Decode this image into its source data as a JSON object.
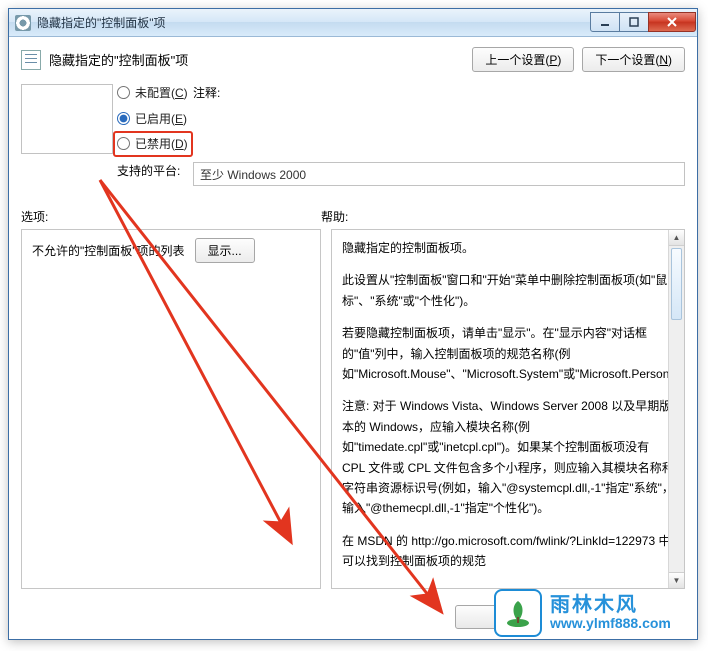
{
  "window": {
    "title": "隐藏指定的\"控制面板\"项"
  },
  "header": {
    "doc_title": "隐藏指定的\"控制面板\"项",
    "prev_label": "上一个设置(",
    "prev_key": "P",
    "next_label": "下一个设置(",
    "next_key": "N",
    "close_paren": ")"
  },
  "radios": {
    "not_configured": "未配置(",
    "not_configured_key": "C",
    "enabled": "已启用(",
    "enabled_key": "E",
    "disabled": "已禁用(",
    "disabled_key": "D"
  },
  "labels": {
    "comment": "注释:",
    "platform": "支持的平台:",
    "options": "选项:",
    "help": "帮助:"
  },
  "platform_value": "至少 Windows 2000",
  "options_panel": {
    "list_label": "不允许的\"控制面板\"项的列表",
    "show_button": "显示..."
  },
  "help_text": {
    "p1": "隐藏指定的控制面板项。",
    "p2": "此设置从\"控制面板\"窗口和\"开始\"菜单中删除控制面板项(如\"鼠标\"、\"系统\"或\"个性化\")。",
    "p3": "若要隐藏控制面板项，请单击\"显示\"。在\"显示内容\"对话框的\"值\"列中，输入控制面板项的规范名称(例如\"Microsoft.Mouse\"、\"Microsoft.System\"或\"Microsoft.Personalization\")。",
    "p4": "注意: 对于 Windows Vista、Windows Server 2008 以及早期版本的 Windows，应输入模块名称(例如\"timedate.cpl\"或\"inetcpl.cpl\")。如果某个控制面板项没有 CPL 文件或 CPL 文件包含多个小程序，则应输入其模块名称和字符串资源标识号(例如，输入\"@systemcpl.dll,-1\"指定\"系统\"，输入\"@themecpl.dll,-1\"指定\"个性化\")。",
    "p5": "在 MSDN 的 http://go.microsoft.com/fwlink/?LinkId=122973 中可以找到控制面板项的规范"
  },
  "watermark": {
    "brand": "雨林木风",
    "url": "www.ylmf888.com"
  }
}
